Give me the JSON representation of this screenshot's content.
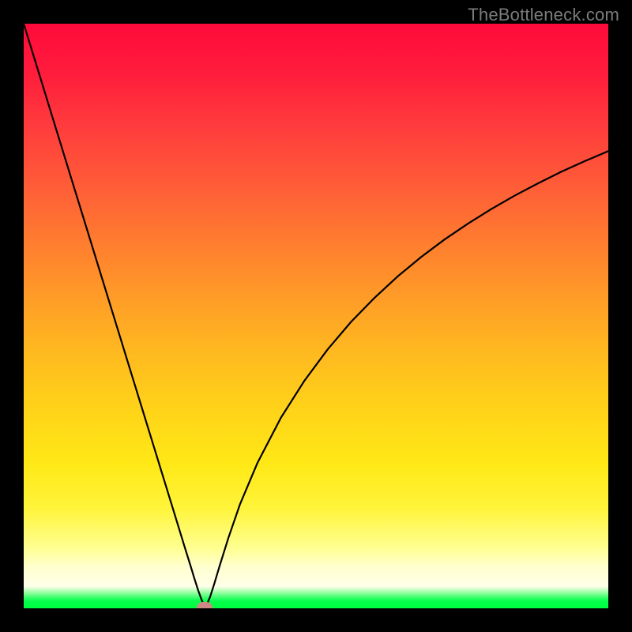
{
  "watermark": "TheBottleneck.com",
  "colors": {
    "frame": "#000000",
    "curve": "#000000",
    "marker": "#cd8984",
    "gradient_stops": [
      "#ff0a3a",
      "#ff7a30",
      "#ffd219",
      "#ffff90",
      "#00ff40"
    ]
  },
  "chart_data": {
    "type": "line",
    "title": "",
    "xlabel": "",
    "ylabel": "",
    "xlim": [
      0,
      100
    ],
    "ylim": [
      0,
      100
    ],
    "grid": false,
    "legend": null,
    "series": [
      {
        "name": "bottleneck-curve",
        "x": [
          0,
          2,
          4,
          6,
          8,
          10,
          12,
          14,
          16,
          18,
          20,
          22,
          24,
          26,
          27.5,
          28.5,
          29.2,
          29.8,
          30.3,
          30.7,
          31.0,
          31.4,
          31.9,
          32.6,
          33.5,
          35,
          37,
          40,
          44,
          48,
          52,
          56,
          60,
          64,
          68,
          72,
          76,
          80,
          84,
          88,
          92,
          96,
          100
        ],
        "y": [
          100,
          93.5,
          87.0,
          80.5,
          74.0,
          67.5,
          61.0,
          54.5,
          48.0,
          41.5,
          35.0,
          28.5,
          22.0,
          15.5,
          10.6,
          7.4,
          5.1,
          3.2,
          1.8,
          0.8,
          0.2,
          0.8,
          2.0,
          4.2,
          7.2,
          12.0,
          17.8,
          24.9,
          32.6,
          38.9,
          44.3,
          49.0,
          53.1,
          56.8,
          60.1,
          63.1,
          65.8,
          68.3,
          70.6,
          72.7,
          74.7,
          76.5,
          78.2
        ]
      }
    ],
    "annotations": [
      {
        "name": "min-marker",
        "x": 31.0,
        "y": 0.2,
        "shape": "rounded-rect",
        "color": "#cd8984"
      }
    ]
  }
}
